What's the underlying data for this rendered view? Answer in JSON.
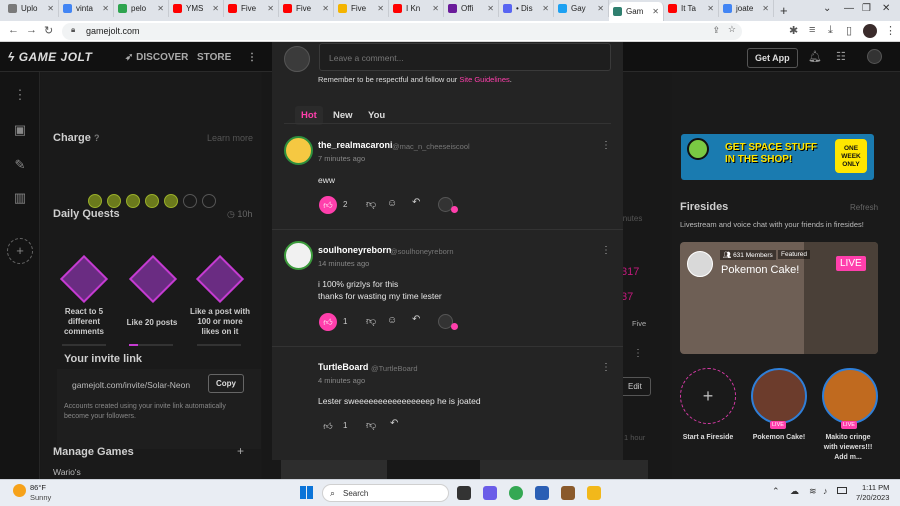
{
  "browser": {
    "tabs": [
      {
        "label": "Uplo",
        "color": "#7a7a7a"
      },
      {
        "label": "vinta",
        "color": "#4285f4"
      },
      {
        "label": "pelo",
        "color": "#2ea44f"
      },
      {
        "label": "YMS",
        "color": "#ff0000"
      },
      {
        "label": "Five",
        "color": "#ff0000"
      },
      {
        "label": "Five",
        "color": "#ff0000"
      },
      {
        "label": "Five",
        "color": "#f4b400"
      },
      {
        "label": "I Kn",
        "color": "#ff0000"
      },
      {
        "label": "Offi",
        "color": "#6a1b9a"
      },
      {
        "label": "• Dis",
        "color": "#5865f2"
      },
      {
        "label": "Gay",
        "color": "#1da1f2"
      },
      {
        "label": "Gam",
        "color": "#2f7f6f",
        "active": true
      },
      {
        "label": "It Ta",
        "color": "#ff0000"
      },
      {
        "label": "joate",
        "color": "#4285f4"
      }
    ],
    "url": "gamejolt.com"
  },
  "site": {
    "logo": "GAME JOLT",
    "nav": {
      "discover": "DISCOVER",
      "store": "STORE",
      "get_app": "Get App"
    },
    "left": {
      "charge_title": "Charge",
      "learn_more": "Learn more",
      "daily_quests_title": "Daily Quests",
      "quests_timer": "10h",
      "quests": [
        {
          "label": "React to 5 different comments"
        },
        {
          "label": "Like 20 posts"
        },
        {
          "label": "Like a post with 100 or more likes on it"
        }
      ],
      "invite_title": "Your invite link",
      "invite_url": "gamejolt.com/invite/Solar-Neon",
      "copy_label": "Copy",
      "invite_note": "Accounts created using your invite link automatically become your followers.",
      "manage_games_title": "Manage Games",
      "game_item": "Wario's"
    },
    "right": {
      "banner_text": "GET SPACE STUFF IN THE SHOP!",
      "banner_badge": "ONE WEEK ONLY",
      "firesides_title": "Firesides",
      "refresh": "Refresh",
      "firesides_desc": "Livestream and voice chat with your friends in firesides!",
      "featured_members": "631 Members",
      "featured_tag": "Featured",
      "featured_title": "Pokemon Cake!",
      "live_badge": "LIVE",
      "circles": [
        {
          "label": "Start a Fireside"
        },
        {
          "label": "Pokemon Cake!"
        },
        {
          "label": "Makito cringe with viewers!!! Add m..."
        }
      ]
    },
    "bg_fragments": {
      "num1": "317",
      "num2": "37",
      "five": "Five",
      "edit": "Edit",
      "hour": "1 hour",
      "minutes": "inutes"
    }
  },
  "comments": {
    "placeholder": "Leave a comment...",
    "guidelines_prefix": "Remember to be respectful and follow our ",
    "guidelines_link": "Site Guidelines",
    "guidelines_suffix": ".",
    "tabs": [
      "Hot",
      "New",
      "You"
    ],
    "items": [
      {
        "name": "the_realmacaroni",
        "handle": "@mac_n_cheeseiscool",
        "time": "7 minutes ago",
        "lines": [
          "eww"
        ],
        "likes": "2"
      },
      {
        "name": "soulhoneyreborn",
        "handle": "@soulhoneyreborn",
        "time": "14 minutes ago",
        "lines": [
          "i 100% grizlys for this",
          "thanks for wasting my time lester"
        ],
        "likes": "1"
      },
      {
        "name": "TurtleBoard",
        "handle": "@TurtleBoard",
        "time": "4 minutes ago",
        "lines": [
          "Lester sweeeeeeeeeeeeeeeep he is joated"
        ],
        "likes": "1"
      }
    ]
  },
  "taskbar": {
    "temp": "86°F",
    "weather": "Sunny",
    "search": "Search",
    "time": "1:11 PM",
    "date": "7/20/2023"
  }
}
